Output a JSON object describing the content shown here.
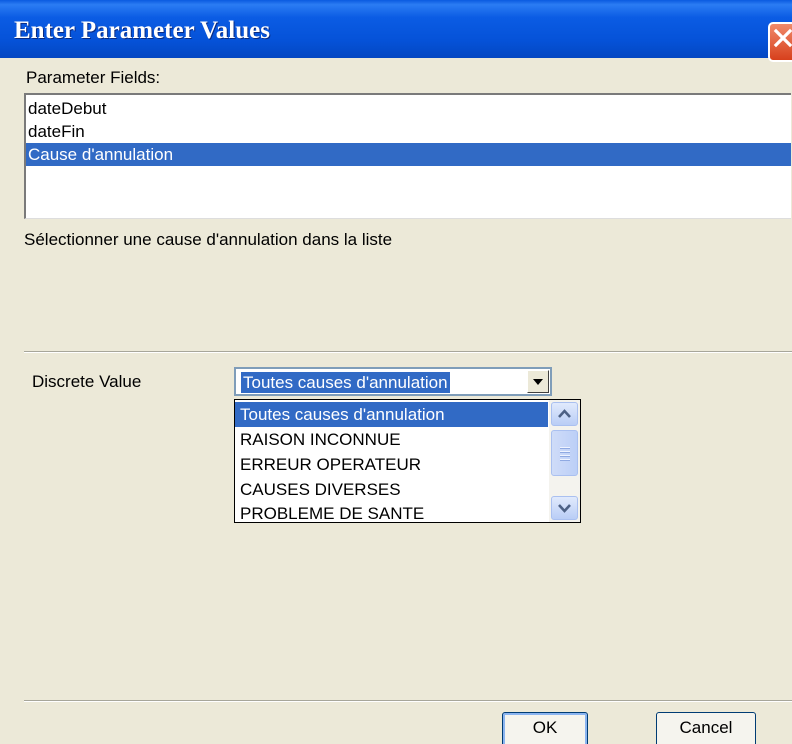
{
  "window": {
    "title": "Enter Parameter Values"
  },
  "parameter_fields": {
    "label": "Parameter Fields:",
    "items": [
      "dateDebut",
      "dateFin",
      "Cause d'annulation"
    ],
    "selected": "Cause d'annulation"
  },
  "description": "Sélectionner une cause d'annulation dans la liste",
  "discrete_value": {
    "label": "Discrete Value",
    "selected": "Toutes causes d'annulation",
    "options": [
      "Toutes causes d'annulation",
      "RAISON INCONNUE",
      "ERREUR OPERATEUR",
      "CAUSES DIVERSES",
      "PROBLEME DE SANTE"
    ]
  },
  "buttons": {
    "ok": "OK",
    "cancel": "Cancel"
  },
  "colors": {
    "title_bar": "#0552d8",
    "selection": "#316ac5",
    "dialog_background": "#ece9d8",
    "close_button": "#d7401c"
  }
}
